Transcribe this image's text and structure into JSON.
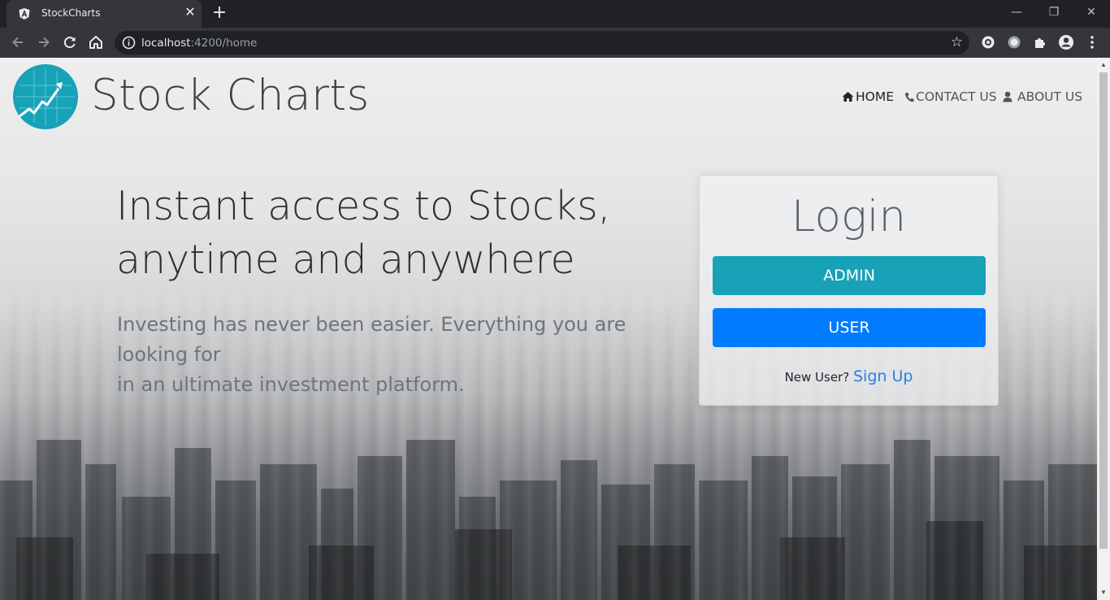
{
  "browser": {
    "tab_title": "StockCharts",
    "url_host": "localhost",
    "url_rest": ":4200/home",
    "close_glyph": "✕",
    "new_tab_glyph": "+",
    "minimize_glyph": "—",
    "restore_glyph": "❐",
    "win_close_glyph": "✕"
  },
  "header": {
    "brand": "Stock Charts",
    "nav": [
      {
        "label": "HOME",
        "icon": "home-icon",
        "active": true
      },
      {
        "label": "CONTACT US",
        "icon": "phone-icon",
        "active": false
      },
      {
        "label": "ABOUT US",
        "icon": "user-icon",
        "active": false
      }
    ]
  },
  "hero": {
    "headline_line1": "Instant access to Stocks,",
    "headline_line2": "anytime and anywhere",
    "subtitle_line1": "Investing has never been easier. Everything you are looking for",
    "subtitle_line2": "in an ultimate investment platform."
  },
  "login": {
    "title": "Login",
    "admin_label": "ADMIN",
    "user_label": "USER",
    "new_user_text": "New User?",
    "signup_label": "Sign Up"
  },
  "colors": {
    "admin_button": "#17a2b8",
    "user_button": "#007bff",
    "link": "#2b7ee0",
    "logo": "#17a2b8"
  }
}
